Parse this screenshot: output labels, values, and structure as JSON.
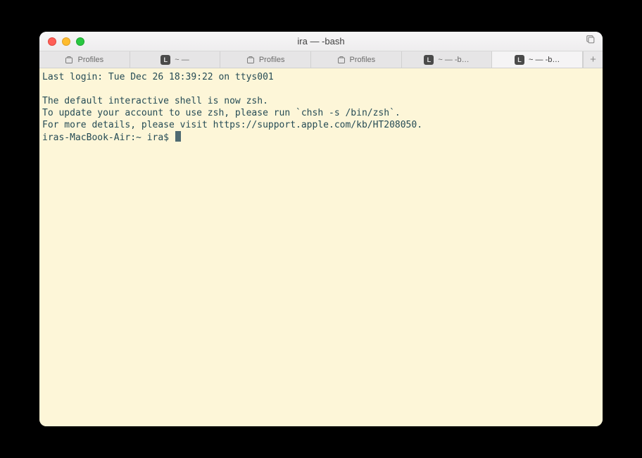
{
  "window": {
    "title": "ira — -bash"
  },
  "tabs": {
    "items": [
      {
        "label": "Profiles",
        "type": "profiles"
      },
      {
        "label": "~ —",
        "type": "shell"
      },
      {
        "label": "Profiles",
        "type": "profiles"
      },
      {
        "label": "Profiles",
        "type": "profiles"
      },
      {
        "label": "~ — -b…",
        "type": "shell"
      },
      {
        "label": "~ — -b…",
        "type": "shell"
      }
    ],
    "active_index": 5,
    "newtab_label": "+"
  },
  "terminal": {
    "line1": "Last login: Tue Dec 26 18:39:22 on ttys001",
    "line2": "",
    "line3": "The default interactive shell is now zsh.",
    "line4": "To update your account to use zsh, please run `chsh -s /bin/zsh`.",
    "line5": "For more details, please visit https://support.apple.com/kb/HT208050.",
    "prompt": "iras-MacBook-Air:~ ira$ "
  },
  "icons": {
    "badge_letter": "L"
  },
  "colors": {
    "terminal_bg": "#fdf6d8",
    "terminal_fg": "#254b55"
  }
}
